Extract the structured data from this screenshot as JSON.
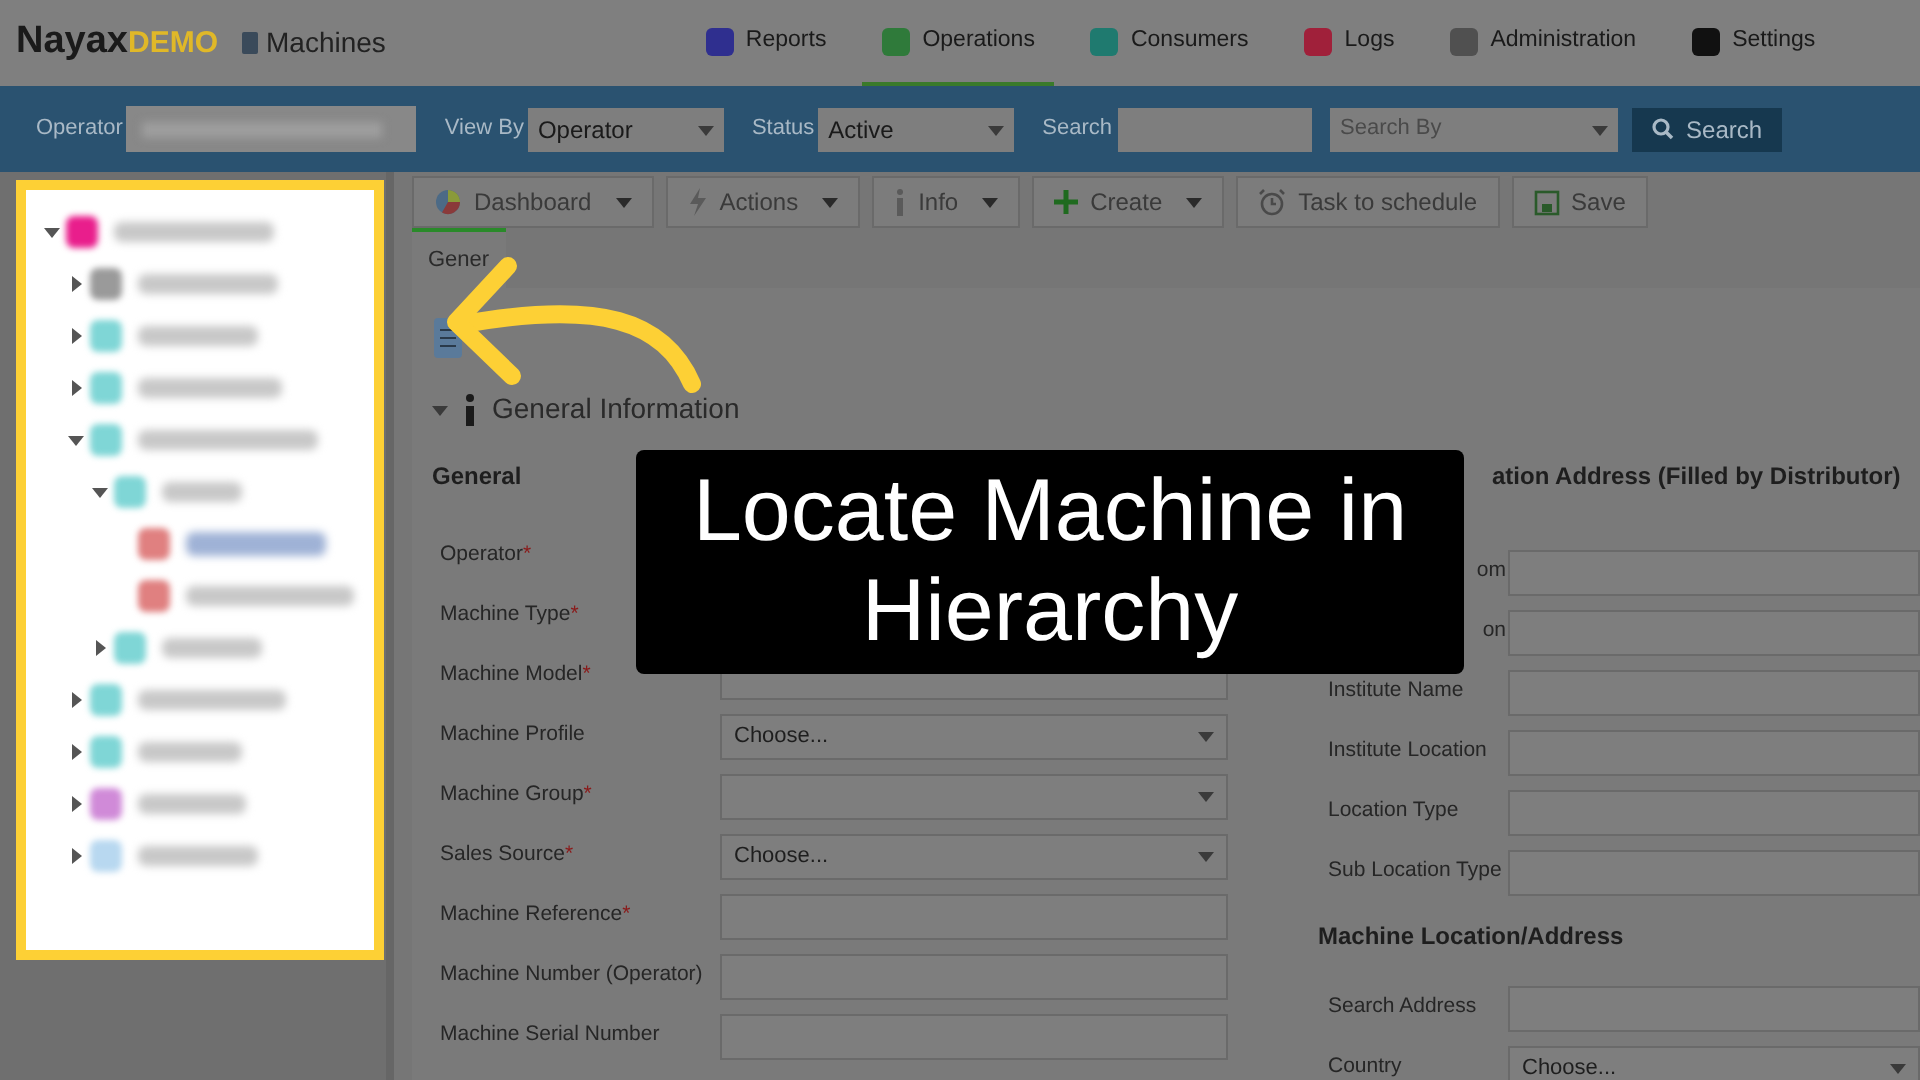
{
  "header": {
    "logo_main": "Nayax",
    "logo_sub": "DEMO",
    "page_title": "Machines",
    "nav": [
      {
        "label": "Reports",
        "color": "#2f2f8f",
        "selected": false
      },
      {
        "label": "Operations",
        "color": "#2f7a3a",
        "selected": true
      },
      {
        "label": "Consumers",
        "color": "#1f7a6f",
        "selected": false
      },
      {
        "label": "Logs",
        "color": "#a0203a",
        "selected": false
      },
      {
        "label": "Administration",
        "color": "#505050",
        "selected": false
      },
      {
        "label": "Settings",
        "color": "#111111",
        "selected": false
      }
    ]
  },
  "filter_bar": {
    "operator_label": "Operator",
    "view_by_label": "View By",
    "view_by_value": "Operator",
    "status_label": "Status",
    "status_value": "Active",
    "search_label": "Search",
    "search_by_placeholder": "Search By",
    "search_button": "Search"
  },
  "tree": [
    {
      "color": "#e91e8c",
      "expanded": true,
      "selected": false,
      "children": [
        {
          "color": "#9a9a9a",
          "expanded": false,
          "selected": false
        },
        {
          "color": "#7fd6d6",
          "expanded": false,
          "selected": false
        },
        {
          "color": "#7fd6d6",
          "expanded": false,
          "selected": false
        },
        {
          "color": "#7fd6d6",
          "expanded": true,
          "selected": false,
          "children": [
            {
              "color": "#7fd6d6",
              "expanded": true,
              "selected": false,
              "children": [
                {
                  "color": "#e08080",
                  "selected": true
                },
                {
                  "color": "#e08080",
                  "selected": false
                }
              ]
            },
            {
              "color": "#7fd6d6",
              "expanded": false,
              "selected": false
            }
          ]
        },
        {
          "color": "#7fd6d6",
          "expanded": false,
          "selected": false
        },
        {
          "color": "#7fd6d6",
          "expanded": false,
          "selected": false
        },
        {
          "color": "#d08ad8",
          "expanded": false,
          "selected": false
        },
        {
          "color": "#b8d8f0",
          "expanded": false,
          "selected": false
        }
      ]
    }
  ],
  "toolbar": [
    {
      "label": "Dashboard",
      "kind": "dropdown"
    },
    {
      "label": "Actions",
      "kind": "dropdown"
    },
    {
      "label": "Info",
      "kind": "dropdown"
    },
    {
      "label": "Create",
      "kind": "dropdown"
    },
    {
      "label": "Task to schedule",
      "kind": "button"
    },
    {
      "label": "Save",
      "kind": "button"
    }
  ],
  "tabs": [
    {
      "label": "Gener",
      "selected": true
    }
  ],
  "section_title": "General Information",
  "left_heading": "General",
  "left_fields": [
    {
      "label": "Operator",
      "required_mark": "*"
    },
    {
      "label": "Machine Type",
      "required_mark": "*"
    },
    {
      "label": "Machine Model",
      "required_mark": "*",
      "kind": "text"
    },
    {
      "label": "Machine Profile",
      "kind": "select",
      "value": "Choose..."
    },
    {
      "label": "Machine Group",
      "required_mark": "*",
      "kind": "select"
    },
    {
      "label": "Sales Source",
      "required_mark": "*",
      "kind": "select",
      "value": "Choose..."
    },
    {
      "label": "Machine Reference",
      "required_mark": "*",
      "kind": "text"
    },
    {
      "label": "Machine Number (Operator)",
      "kind": "text"
    },
    {
      "label": "Machine Serial Number",
      "kind": "text"
    }
  ],
  "right_heading": "ation Address (Filled by Distributor)",
  "right_fields": [
    {
      "label": "om",
      "kind": "text"
    },
    {
      "label": "on",
      "kind": "text"
    },
    {
      "label": "Institute Name",
      "kind": "text"
    },
    {
      "label": "Institute Location",
      "kind": "text"
    },
    {
      "label": "Location Type",
      "kind": "text"
    },
    {
      "label": "Sub Location Type",
      "kind": "text"
    }
  ],
  "right_heading_2": "Machine Location/Address",
  "right_fields_2": [
    {
      "label": "Search Address",
      "kind": "text"
    },
    {
      "label": "Country",
      "kind": "select",
      "value": "Choose..."
    }
  ],
  "callout": {
    "text": "Locate Machine in Hierarchy"
  }
}
